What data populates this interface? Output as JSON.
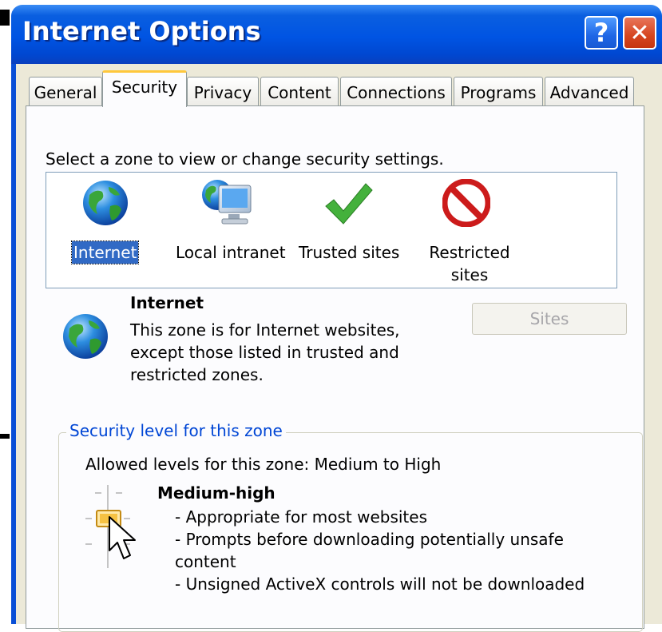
{
  "window": {
    "title": "Internet Options",
    "help_glyph": "?",
    "close_glyph": "✕"
  },
  "tabs": [
    {
      "label": "General",
      "active": false
    },
    {
      "label": "Security",
      "active": true
    },
    {
      "label": "Privacy",
      "active": false
    },
    {
      "label": "Content",
      "active": false
    },
    {
      "label": "Connections",
      "active": false
    },
    {
      "label": "Programs",
      "active": false
    },
    {
      "label": "Advanced",
      "active": false
    }
  ],
  "security": {
    "instruction": "Select a zone to view or change security settings.",
    "zones": [
      {
        "label": "Internet",
        "icon": "globe-icon",
        "selected": true
      },
      {
        "label": "Local intranet",
        "icon": "intranet-icon",
        "selected": false
      },
      {
        "label": "Trusted sites",
        "icon": "checkmark-icon",
        "selected": false
      },
      {
        "label_line1": "Restricted",
        "label_line2": "sites",
        "icon": "no-entry-icon",
        "selected": false
      }
    ],
    "selected_zone": {
      "name": "Internet",
      "desc_line1": "This zone is for Internet websites,",
      "desc_line2": "except those listed in trusted and",
      "desc_line3": "restricted zones."
    },
    "sites_button": "Sites",
    "level_group": {
      "title": "Security level for this zone",
      "allowed": "Allowed levels for this zone: Medium to High",
      "level_name": "Medium-high",
      "bullet1": "- Appropriate for most websites",
      "bullet2a": "- Prompts before downloading potentially unsafe",
      "bullet2b": "content",
      "bullet3": "- Unsigned ActiveX controls will not be downloaded"
    }
  },
  "colors": {
    "title_bar": "#0054e3",
    "selection": "#316ac5",
    "group_title": "#0046d5",
    "active_tab_accent": "#ffc83c"
  }
}
